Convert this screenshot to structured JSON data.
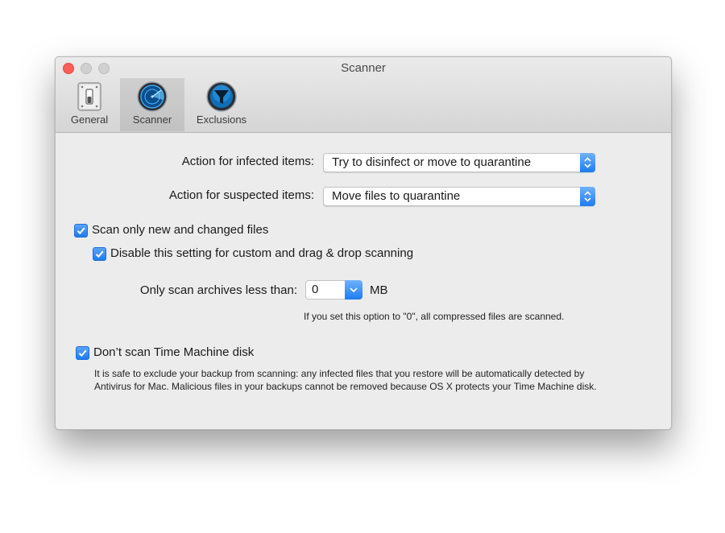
{
  "window": {
    "title": "Scanner"
  },
  "toolbar": {
    "tabs": [
      {
        "label": "General",
        "icon": "switch-panel-icon"
      },
      {
        "label": "Scanner",
        "icon": "radar-icon",
        "active": true
      },
      {
        "label": "Exclusions",
        "icon": "filter-funnel-icon"
      }
    ]
  },
  "settings": {
    "infected_label": "Action for infected items:",
    "infected_value": "Try to disinfect or move to quarantine",
    "suspected_label": "Action for suspected items:",
    "suspected_value": "Move files to quarantine",
    "scan_new_label": "Scan only new and changed files",
    "disable_custom_label": "Disable this setting for custom and drag & drop scanning",
    "archive_label": "Only scan archives less than:",
    "archive_value": "0",
    "archive_unit": "MB",
    "archive_note": "If you set this option to \"0\", all compressed files are scanned.",
    "time_machine_label": "Don’t scan Time Machine disk",
    "time_machine_note_1": "It is safe to exclude your backup from scanning: any infected files that you restore will be automatically detected by",
    "time_machine_note_2": "Antivirus for Mac. Malicious files in your backups cannot be removed because OS X protects your Time Machine disk."
  },
  "checkboxes": {
    "scan_new": true,
    "disable_custom": true,
    "time_machine": true
  },
  "colors": {
    "accent": "#1e7bf0",
    "close_button": "#fc5f57"
  }
}
